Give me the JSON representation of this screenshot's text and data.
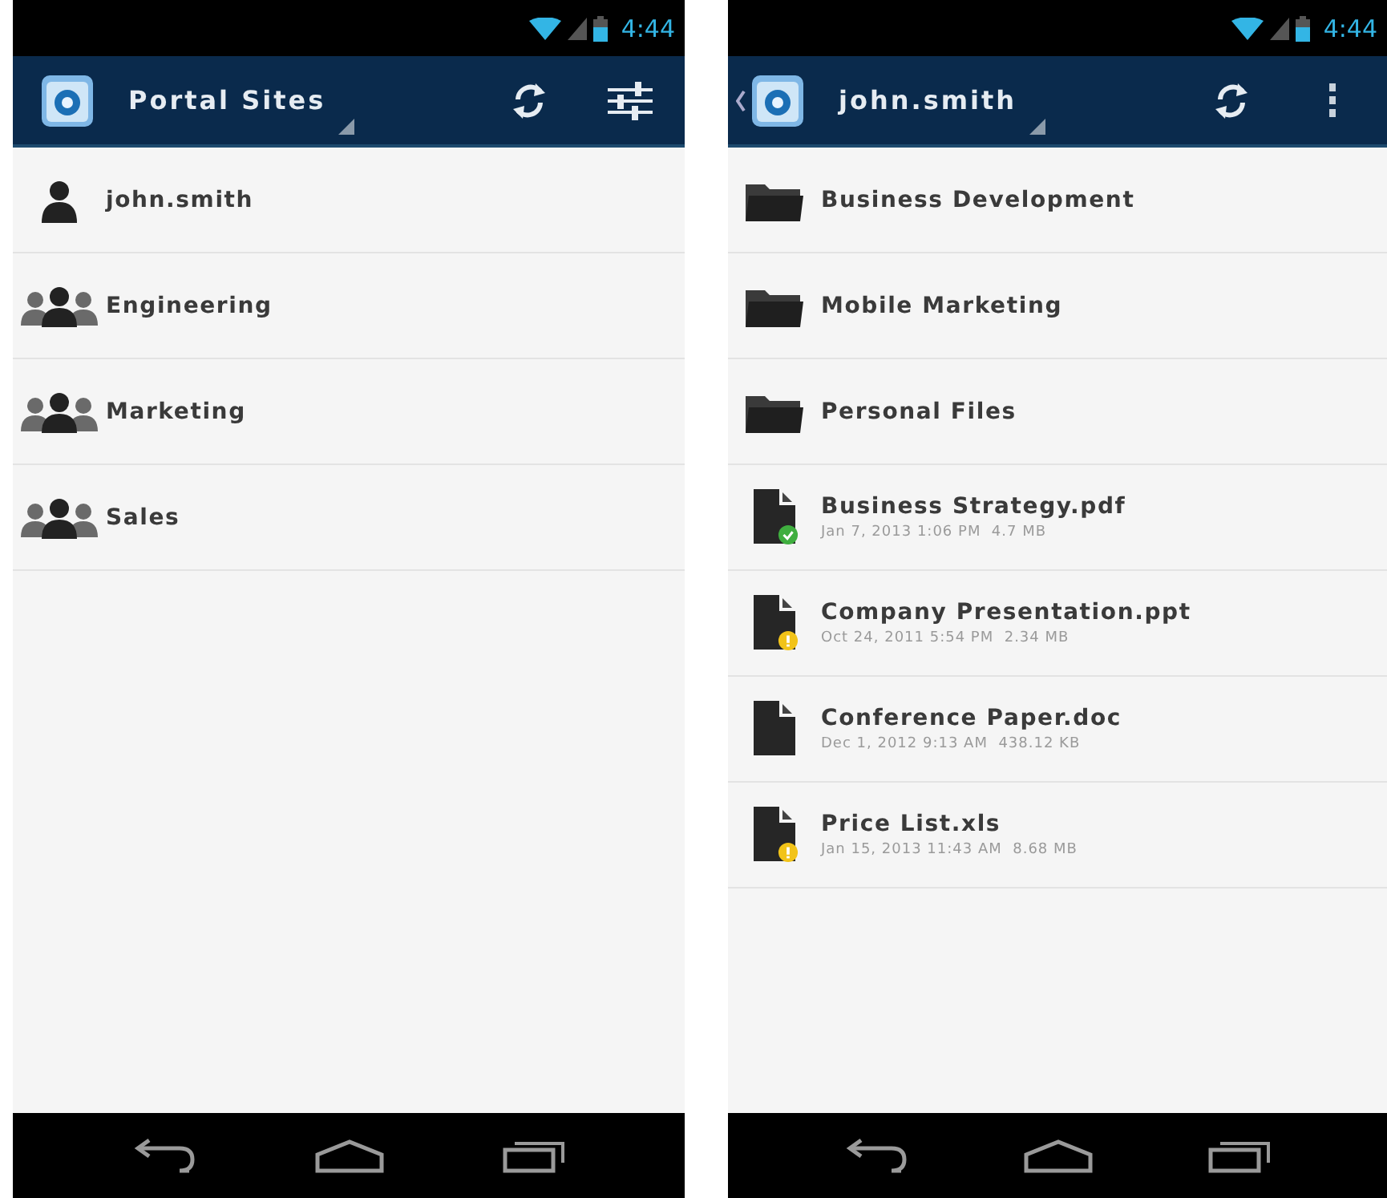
{
  "phones": [
    {
      "status_bar": {
        "time": "4:44"
      },
      "action_bar": {
        "back": false,
        "title": "Portal Sites",
        "actions": [
          {
            "kind": "refresh"
          },
          {
            "kind": "settings"
          }
        ]
      },
      "items": [
        {
          "kind": "user",
          "label": "john.smith"
        },
        {
          "kind": "group",
          "label": "Engineering"
        },
        {
          "kind": "group",
          "label": "Marketing"
        },
        {
          "kind": "group",
          "label": "Sales"
        }
      ]
    },
    {
      "status_bar": {
        "time": "4:44"
      },
      "action_bar": {
        "back": true,
        "title": "john.smith",
        "actions": [
          {
            "kind": "refresh"
          },
          {
            "kind": "overflow"
          }
        ]
      },
      "items": [
        {
          "kind": "folder",
          "label": "Business Development"
        },
        {
          "kind": "folder",
          "label": "Mobile Marketing"
        },
        {
          "kind": "folder",
          "label": "Personal Files"
        },
        {
          "kind": "file",
          "label": "Business Strategy.pdf",
          "details": "Jan 7, 2013 1:06 PM  4.7 MB",
          "badge": {
            "kind": "synced"
          }
        },
        {
          "kind": "file",
          "label": "Company Presentation.ppt",
          "details": "Oct 24, 2011 5:54 PM  2.34 MB",
          "badge": {
            "kind": "pending"
          }
        },
        {
          "kind": "file",
          "label": "Conference Paper.doc",
          "details": "Dec 1, 2012 9:13 AM  438.12 KB"
        },
        {
          "kind": "file",
          "label": "Price List.xls",
          "details": "Jan 15, 2013 11:43 AM  8.68 MB",
          "badge": {
            "kind": "pending"
          }
        }
      ]
    }
  ]
}
